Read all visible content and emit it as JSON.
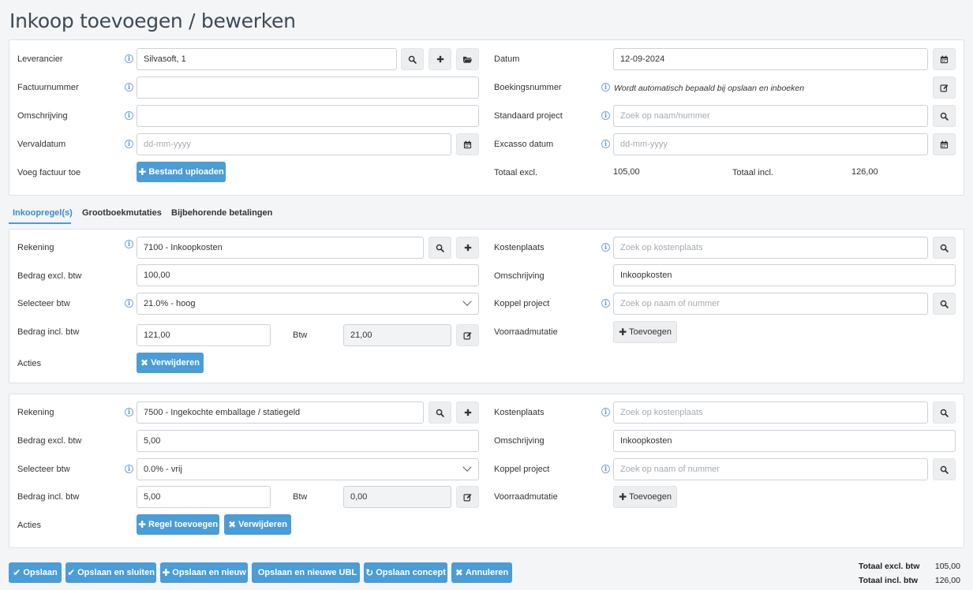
{
  "page": {
    "title": "Inkoop toevoegen / bewerken"
  },
  "header": {
    "leverancier": {
      "label": "Leverancier",
      "value": "Silvasoft, 1"
    },
    "factuurnummer": {
      "label": "Factuurnummer",
      "value": ""
    },
    "omschrijving": {
      "label": "Omschrijving",
      "value": ""
    },
    "vervaldatum": {
      "label": "Vervaldatum",
      "placeholder": "dd-mm-yyyy"
    },
    "voeg_factuur": {
      "label": "Voeg factuur toe",
      "button": "Bestand uploaden"
    },
    "datum": {
      "label": "Datum",
      "value": "12-09-2024"
    },
    "boekingsnummer": {
      "label": "Boekingsnummer",
      "note": "Wordt automatisch bepaald bij opslaan en inboeken"
    },
    "standaard_project": {
      "label": "Standaard project",
      "placeholder": "Zoek op naam/nummer"
    },
    "excasso_datum": {
      "label": "Excasso datum",
      "placeholder": "dd-mm-yyyy"
    },
    "totaal_excl": {
      "label": "Totaal excl.",
      "value": "105,00"
    },
    "totaal_incl": {
      "label": "Totaal incl.",
      "value": "126,00"
    }
  },
  "tabs": [
    {
      "label": "Inkoopregel(s)",
      "active": true
    },
    {
      "label": "Grootboekmutaties",
      "active": false
    },
    {
      "label": "Bijbehorende betalingen",
      "active": false
    }
  ],
  "labels": {
    "rekening": "Rekening",
    "bedrag_excl": "Bedrag excl. btw",
    "selecteer_btw": "Selecteer btw",
    "bedrag_incl": "Bedrag incl. btw",
    "btw": "Btw",
    "acties": "Acties",
    "kostenplaats": "Kostenplaats",
    "omschrijving": "Omschrijving",
    "koppel_project": "Koppel project",
    "voorraadmutatie": "Voorraadmutatie",
    "kostenplaats_placeholder": "Zoek op kostenplaats",
    "project_placeholder": "Zoek op naam of nummer",
    "toevoegen": "Toevoegen",
    "verwijderen": "Verwijderen",
    "regel_toevoegen": "Regel toevoegen"
  },
  "lines": [
    {
      "rekening": "7100 - Inkoopkosten",
      "bedrag_excl": "100,00",
      "btw_option": "21.0% - hoog",
      "bedrag_incl": "121,00",
      "btw": "21,00",
      "omschrijving": "Inkoopkosten"
    },
    {
      "rekening": "7500 - Ingekochte emballage / statiegeld",
      "bedrag_excl": "5,00",
      "btw_option": "0.0% - vrij",
      "bedrag_incl": "5,00",
      "btw": "0,00",
      "omschrijving": "Inkoopkosten"
    }
  ],
  "footer": {
    "buttons": [
      "Opslaan",
      "Opslaan en sluiten",
      "Opslaan en nieuw",
      "Opslaan en nieuwe UBL",
      "Opslaan concept",
      "Annuleren"
    ],
    "totaal_excl_label": "Totaal excl. btw",
    "totaal_excl_value": "105,00",
    "totaal_incl_label": "Totaal incl. btw",
    "totaal_incl_value": "126,00"
  },
  "icons": {
    "info_glyph": "i",
    "plus_glyph": "✚",
    "times_glyph": "✖",
    "check_glyph": "✔",
    "refresh_glyph": "↻"
  },
  "colors": {
    "accent": "#4a9dd6",
    "title": "#3c4a58",
    "tab_active": "#3d8ac7"
  }
}
